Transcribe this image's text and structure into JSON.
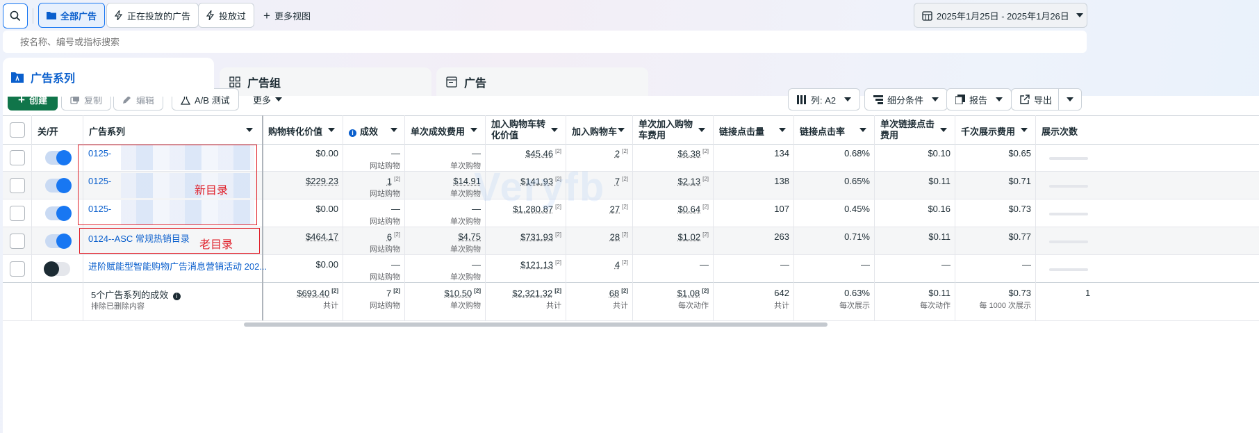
{
  "topbar": {
    "all_ads": "全部广告",
    "active_ads": "正在投放的广告",
    "delivered": "投放过",
    "more_views": "更多视图",
    "date_range": "2025年1月25日 - 2025年1月26日"
  },
  "search": {
    "placeholder": "按名称、编号或指标搜索"
  },
  "tabs": [
    {
      "label": "广告系列"
    },
    {
      "label": "广告组"
    },
    {
      "label": "广告"
    }
  ],
  "toolbar": {
    "create": "创建",
    "copy": "复制",
    "edit": "编辑",
    "ab_test": "A/B 测试",
    "more": "更多",
    "columns": "列: A2",
    "breakdown": "细分条件",
    "reports": "报告",
    "export": "导出"
  },
  "table": {
    "headers": {
      "onoff": "关/开",
      "campaign": "广告系列",
      "value": "购物转化价值",
      "results": "成效",
      "cpr": "单次成效费用",
      "atc_value": "加入购物车转化价值",
      "atc": "加入购物车",
      "cost_atc": "单次加入购物车费用",
      "link_clicks": "链接点击量",
      "ctr": "链接点击率",
      "cpc": "单次链接点击费用",
      "cpm": "千次展示费用",
      "impressions": "展示次数"
    },
    "rows": [
      {
        "name": "0125-",
        "on": true,
        "value": "$0.00",
        "results": "—",
        "results_sub": "网站购物",
        "cpr": "—",
        "cpr_sub": "单次购物",
        "atc_value": "$45.46",
        "atc": "2",
        "cost_atc": "$6.38",
        "clicks": "134",
        "ctr": "0.68%",
        "cpc": "$0.10",
        "cpm": "$0.65"
      },
      {
        "name": "0125-",
        "on": true,
        "value": "$229.23",
        "results": "1",
        "results_sub": "网站购物",
        "cpr": "$14.91",
        "cpr_sub": "单次购物",
        "atc_value": "$141.93",
        "atc": "7",
        "cost_atc": "$2.13",
        "clicks": "138",
        "ctr": "0.65%",
        "cpc": "$0.11",
        "cpm": "$0.71"
      },
      {
        "name": "0125-",
        "on": true,
        "value": "$0.00",
        "results": "—",
        "results_sub": "网站购物",
        "cpr": "—",
        "cpr_sub": "单次购物",
        "atc_value": "$1,280.87",
        "atc": "27",
        "cost_atc": "$0.64",
        "clicks": "107",
        "ctr": "0.45%",
        "cpc": "$0.16",
        "cpm": "$0.73"
      },
      {
        "name": "0124--ASC 常规热销目录",
        "on": true,
        "value": "$464.17",
        "results": "6",
        "results_sub": "网站购物",
        "cpr": "$4.75",
        "cpr_sub": "单次购物",
        "atc_value": "$731.93",
        "atc": "28",
        "cost_atc": "$1.02",
        "clicks": "263",
        "ctr": "0.71%",
        "cpc": "$0.11",
        "cpm": "$0.77"
      },
      {
        "name": "进阶赋能型智能购物广告消息营销活动 202...",
        "on": false,
        "value": "$0.00",
        "results": "—",
        "results_sub": "网站购物",
        "cpr": "—",
        "cpr_sub": "单次购物",
        "atc_value": "$121.13",
        "atc": "4",
        "cost_atc": "—",
        "clicks": "—",
        "ctr": "—",
        "cpc": "—",
        "cpm": "—"
      }
    ],
    "totals": {
      "label": "5个广告系列的成效",
      "sub": "排除已删除内容",
      "value": "$693.40",
      "value_sub": "共计",
      "results": "7",
      "results_sub": "网站购物",
      "cpr": "$10.50",
      "cpr_sub": "单次购物",
      "atc_value": "$2,321.32",
      "atc_value_sub": "共计",
      "atc": "68",
      "atc_sub": "共计",
      "cost_atc": "$1.08",
      "cost_atc_sub": "每次动作",
      "clicks": "642",
      "clicks_sub": "共计",
      "ctr": "0.63%",
      "ctr_sub": "每次展示",
      "cpc": "$0.11",
      "cpc_sub": "每次动作",
      "cpm": "$0.73",
      "cpm_sub": "每 1000 次展示",
      "impressions": "1"
    }
  },
  "annotations": {
    "new_catalog": "新目录",
    "old_catalog": "老目录",
    "watermark": "Veryfb"
  },
  "colors": {
    "accent": "#1877f2",
    "create_green": "#10754a",
    "annotation_red": "#e0202a"
  }
}
